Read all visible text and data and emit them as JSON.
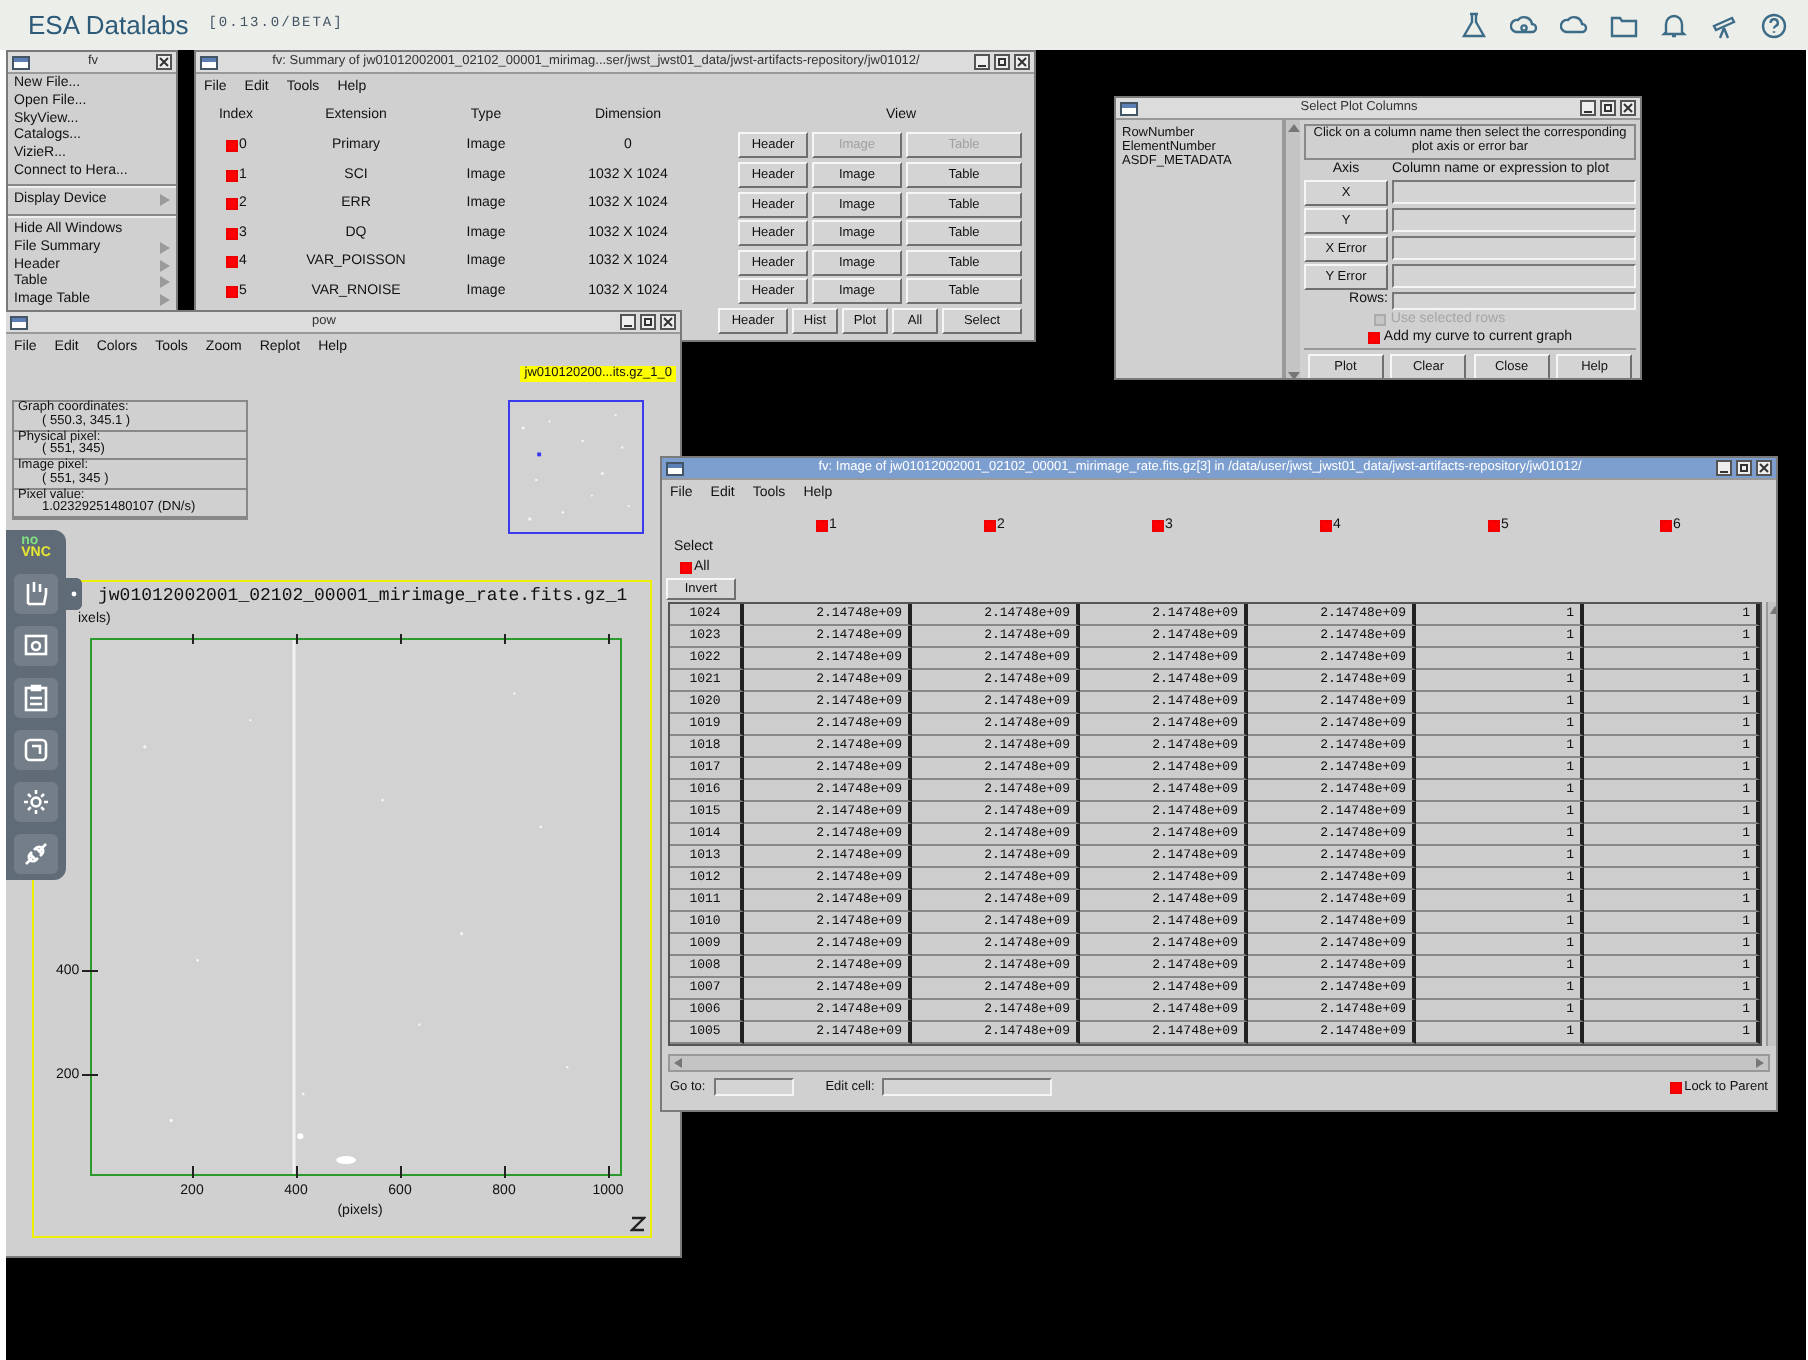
{
  "app_bar": {
    "title": "ESA Datalabs",
    "version": "[0.13.0/BETA]"
  },
  "fv_menu": {
    "title": "fv",
    "items": [
      {
        "kind": "item",
        "label": "New File..."
      },
      {
        "kind": "item",
        "label": "Open File..."
      },
      {
        "kind": "item",
        "label": "SkyView..."
      },
      {
        "kind": "item",
        "label": "Catalogs..."
      },
      {
        "kind": "item",
        "label": "VizieR..."
      },
      {
        "kind": "item",
        "label": "Connect to Hera..."
      },
      {
        "kind": "separator"
      },
      {
        "kind": "submenu",
        "label": "Display Device"
      },
      {
        "kind": "separator"
      },
      {
        "kind": "item",
        "label": "Hide All Windows"
      },
      {
        "kind": "submenu",
        "label": "File Summary"
      },
      {
        "kind": "submenu",
        "label": "Header"
      },
      {
        "kind": "submenu",
        "label": "Table"
      },
      {
        "kind": "submenu",
        "label": "Image Table"
      }
    ]
  },
  "summary_window": {
    "title": "fv: Summary of jw01012002001_02102_00001_mirimag...ser/jwst_jwst01_data/jwst-artifacts-repository/jw01012/",
    "active": false,
    "menu": [
      "File",
      "Edit",
      "Tools",
      "Help"
    ],
    "columns": [
      "Index",
      "Extension",
      "Type",
      "Dimension",
      "View"
    ],
    "rows": [
      {
        "index": "0",
        "checked": true,
        "extension": "Primary",
        "type": "Image",
        "dimension": "0",
        "buttons": [
          {
            "label": "Header",
            "disabled": false
          },
          {
            "label": "Image",
            "disabled": true
          },
          {
            "label": "Table",
            "disabled": true
          }
        ]
      },
      {
        "index": "1",
        "checked": true,
        "extension": "SCI",
        "type": "Image",
        "dimension": "1032 X 1024",
        "buttons": [
          {
            "label": "Header",
            "disabled": false
          },
          {
            "label": "Image",
            "disabled": false
          },
          {
            "label": "Table",
            "disabled": false
          }
        ]
      },
      {
        "index": "2",
        "checked": true,
        "extension": "ERR",
        "type": "Image",
        "dimension": "1032 X 1024",
        "buttons": [
          {
            "label": "Header",
            "disabled": false
          },
          {
            "label": "Image",
            "disabled": false
          },
          {
            "label": "Table",
            "disabled": false
          }
        ]
      },
      {
        "index": "3",
        "checked": true,
        "extension": "DQ",
        "type": "Image",
        "dimension": "1032 X 1024",
        "buttons": [
          {
            "label": "Header",
            "disabled": false
          },
          {
            "label": "Image",
            "disabled": false
          },
          {
            "label": "Table",
            "disabled": false
          }
        ]
      },
      {
        "index": "4",
        "checked": true,
        "extension": "VAR_POISSON",
        "type": "Image",
        "dimension": "1032 X 1024",
        "buttons": [
          {
            "label": "Header",
            "disabled": false
          },
          {
            "label": "Image",
            "disabled": false
          },
          {
            "label": "Table",
            "disabled": false
          }
        ]
      },
      {
        "index": "5",
        "checked": true,
        "extension": "VAR_RNOISE",
        "type": "Image",
        "dimension": "1032 X 1024",
        "buttons": [
          {
            "label": "Header",
            "disabled": false
          },
          {
            "label": "Image",
            "disabled": false
          },
          {
            "label": "Table",
            "disabled": false
          }
        ]
      }
    ],
    "action_buttons": [
      "Header",
      "Hist",
      "Plot",
      "All",
      "Select"
    ]
  },
  "plot_columns_window": {
    "title": "Select Plot Columns",
    "active": false,
    "column_list": [
      "RowNumber",
      "ElementNumber",
      "ASDF_METADATA"
    ],
    "instruction": "Click on a column name then select the corresponding plot axis or error bar",
    "axis_header": "Axis",
    "expression_header": "Column name or expression to plot",
    "axes": [
      "X",
      "Y",
      "X Error",
      "Y Error"
    ],
    "rows_label": "Rows:",
    "options": [
      {
        "label": "Use selected rows",
        "checked": false,
        "disabled": true
      },
      {
        "label": "Add my curve to current graph",
        "checked": true,
        "disabled": false
      }
    ],
    "buttons": [
      "Plot",
      "Clear",
      "Close",
      "Help"
    ]
  },
  "pow_window": {
    "title": "pow",
    "active": false,
    "menu": [
      "File",
      "Edit",
      "Colors",
      "Tools",
      "Zoom",
      "Replot",
      "Help"
    ],
    "graph_label": "jw010120200...its.gz_1_0",
    "readouts": [
      {
        "label": "Graph coordinates:",
        "value": "( 550.3, 345.1 )"
      },
      {
        "label": "Physical pixel:",
        "value": "( 551, 345)"
      },
      {
        "label": "Image pixel:",
        "value": "( 551, 345 )"
      },
      {
        "label": "Pixel value:",
        "value": "1.02329251480107 (DN/s)"
      }
    ],
    "plot": {
      "title": "jw01012002001_02102_00001_mirimage_rate.fits.gz_1",
      "y_label": "ixels)",
      "y_ticks": [
        "400",
        "200"
      ],
      "x_ticks": [
        "200",
        "400",
        "600",
        "800",
        "1000"
      ],
      "x_label": "(pixels)"
    }
  },
  "vnc_panel": {
    "logo": [
      "no",
      "VNC"
    ]
  },
  "table_window": {
    "title": "fv: Image of jw01012002001_02102_00001_mirimage_rate.fits.gz[3] in /data/user/jwst_jwst01_data/jwst-artifacts-repository/jw01012/",
    "active": true,
    "menu": [
      "File",
      "Edit",
      "Tools",
      "Help"
    ],
    "columns": [
      {
        "label": "1",
        "checked": true
      },
      {
        "label": "2",
        "checked": true
      },
      {
        "label": "3",
        "checked": true
      },
      {
        "label": "4",
        "checked": true
      },
      {
        "label": "5",
        "checked": true
      },
      {
        "label": "6",
        "checked": true
      }
    ],
    "select_label": "Select",
    "select_all": {
      "label": "All",
      "checked": true
    },
    "invert_button": "Invert",
    "rows": [
      {
        "row": "1024",
        "values": [
          "2.14748e+09",
          "2.14748e+09",
          "2.14748e+09",
          "2.14748e+09",
          "1",
          "1"
        ]
      },
      {
        "row": "1023",
        "values": [
          "2.14748e+09",
          "2.14748e+09",
          "2.14748e+09",
          "2.14748e+09",
          "1",
          "1"
        ]
      },
      {
        "row": "1022",
        "values": [
          "2.14748e+09",
          "2.14748e+09",
          "2.14748e+09",
          "2.14748e+09",
          "1",
          "1"
        ]
      },
      {
        "row": "1021",
        "values": [
          "2.14748e+09",
          "2.14748e+09",
          "2.14748e+09",
          "2.14748e+09",
          "1",
          "1"
        ]
      },
      {
        "row": "1020",
        "values": [
          "2.14748e+09",
          "2.14748e+09",
          "2.14748e+09",
          "2.14748e+09",
          "1",
          "1"
        ]
      },
      {
        "row": "1019",
        "values": [
          "2.14748e+09",
          "2.14748e+09",
          "2.14748e+09",
          "2.14748e+09",
          "1",
          "1"
        ]
      },
      {
        "row": "1018",
        "values": [
          "2.14748e+09",
          "2.14748e+09",
          "2.14748e+09",
          "2.14748e+09",
          "1",
          "1"
        ]
      },
      {
        "row": "1017",
        "values": [
          "2.14748e+09",
          "2.14748e+09",
          "2.14748e+09",
          "2.14748e+09",
          "1",
          "1"
        ]
      },
      {
        "row": "1016",
        "values": [
          "2.14748e+09",
          "2.14748e+09",
          "2.14748e+09",
          "2.14748e+09",
          "1",
          "1"
        ]
      },
      {
        "row": "1015",
        "values": [
          "2.14748e+09",
          "2.14748e+09",
          "2.14748e+09",
          "2.14748e+09",
          "1",
          "1"
        ]
      },
      {
        "row": "1014",
        "values": [
          "2.14748e+09",
          "2.14748e+09",
          "2.14748e+09",
          "2.14748e+09",
          "1",
          "1"
        ]
      },
      {
        "row": "1013",
        "values": [
          "2.14748e+09",
          "2.14748e+09",
          "2.14748e+09",
          "2.14748e+09",
          "1",
          "1"
        ]
      },
      {
        "row": "1012",
        "values": [
          "2.14748e+09",
          "2.14748e+09",
          "2.14748e+09",
          "2.14748e+09",
          "1",
          "1"
        ]
      },
      {
        "row": "1011",
        "values": [
          "2.14748e+09",
          "2.14748e+09",
          "2.14748e+09",
          "2.14748e+09",
          "1",
          "1"
        ]
      },
      {
        "row": "1010",
        "values": [
          "2.14748e+09",
          "2.14748e+09",
          "2.14748e+09",
          "2.14748e+09",
          "1",
          "1"
        ]
      },
      {
        "row": "1009",
        "values": [
          "2.14748e+09",
          "2.14748e+09",
          "2.14748e+09",
          "2.14748e+09",
          "1",
          "1"
        ]
      },
      {
        "row": "1008",
        "values": [
          "2.14748e+09",
          "2.14748e+09",
          "2.14748e+09",
          "2.14748e+09",
          "1",
          "1"
        ]
      },
      {
        "row": "1007",
        "values": [
          "2.14748e+09",
          "2.14748e+09",
          "2.14748e+09",
          "2.14748e+09",
          "1",
          "1"
        ]
      },
      {
        "row": "1006",
        "values": [
          "2.14748e+09",
          "2.14748e+09",
          "2.14748e+09",
          "2.14748e+09",
          "1",
          "1"
        ]
      },
      {
        "row": "1005",
        "values": [
          "2.14748e+09",
          "2.14748e+09",
          "2.14748e+09",
          "2.14748e+09",
          "1",
          "1"
        ]
      }
    ],
    "goto_label": "Go to:",
    "edit_label": "Edit cell:",
    "lock": {
      "label": "Lock to Parent",
      "checked": true
    }
  }
}
